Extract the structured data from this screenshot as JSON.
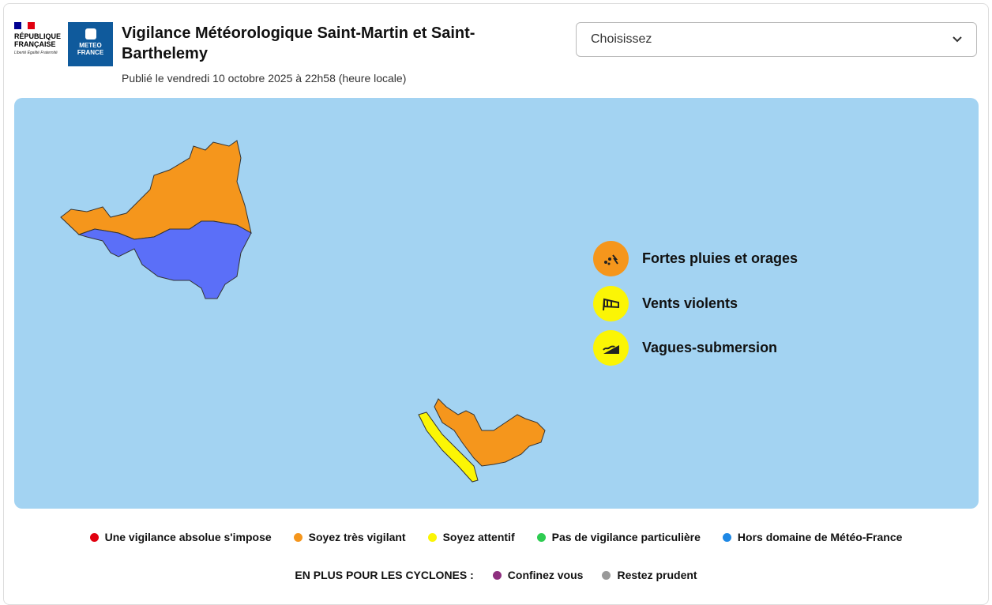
{
  "header": {
    "rf_logo": "RÉPUBLIQUE FRANÇAISE",
    "rf_motto": "Liberté Égalité Fraternité",
    "mf_logo": "METEO FRANCE",
    "title": "Vigilance Météorologique Saint-Martin et Saint-Barthelemy",
    "published": "Publié le vendredi 10 octobre 2025 à 22h58 (heure locale)"
  },
  "select": {
    "value": "Choisissez"
  },
  "colors": {
    "red": "#e1000f",
    "orange": "#f5961c",
    "yellow": "#fbf505",
    "green": "#2ecc51",
    "blue": "#1e88e5",
    "blue_zone": "#5b6ff8",
    "purple": "#8e2f7f",
    "grey": "#999999",
    "sea": "#a3d3f2"
  },
  "risks": [
    {
      "label": "Fortes pluies et orages",
      "icon": "rain-storm-icon",
      "level": "orange"
    },
    {
      "label": "Vents violents",
      "icon": "windsock-icon",
      "level": "yellow"
    },
    {
      "label": "Vagues-submersion",
      "icon": "waves-icon",
      "level": "yellow"
    }
  ],
  "legend": [
    {
      "label": "Une vigilance absolue s'impose",
      "color": "#e1000f"
    },
    {
      "label": "Soyez très vigilant",
      "color": "#f5961c"
    },
    {
      "label": "Soyez attentif",
      "color": "#fbf505"
    },
    {
      "label": "Pas de vigilance particulière",
      "color": "#2ecc51"
    },
    {
      "label": "Hors domaine de Météo-France",
      "color": "#1e88e5"
    }
  ],
  "cyclones": {
    "title": "EN PLUS POUR LES CYCLONES :",
    "items": [
      {
        "label": "Confinez vous",
        "color": "#8e2f7f"
      },
      {
        "label": "Restez prudent",
        "color": "#999999"
      }
    ]
  }
}
